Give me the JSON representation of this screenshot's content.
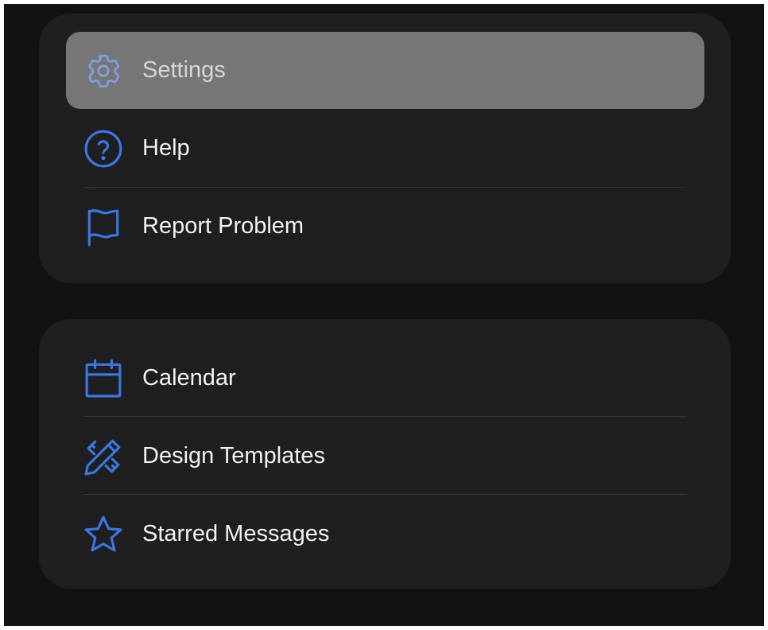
{
  "colors": {
    "accent": "#3b78e7",
    "accent_dim": "#7f9fd9",
    "card_background": "#1f1f1f",
    "page_background": "#121212",
    "highlight_background": "#767676"
  },
  "groups": [
    {
      "items": [
        {
          "label": "Settings",
          "icon": "gear-icon",
          "highlighted": true
        },
        {
          "label": "Help",
          "icon": "question-circle-icon",
          "highlighted": false
        },
        {
          "label": "Report Problem",
          "icon": "flag-icon",
          "highlighted": false
        }
      ]
    },
    {
      "items": [
        {
          "label": "Calendar",
          "icon": "calendar-icon",
          "highlighted": false
        },
        {
          "label": "Design Templates",
          "icon": "pencil-ruler-icon",
          "highlighted": false
        },
        {
          "label": "Starred Messages",
          "icon": "star-icon",
          "highlighted": false
        }
      ]
    }
  ]
}
